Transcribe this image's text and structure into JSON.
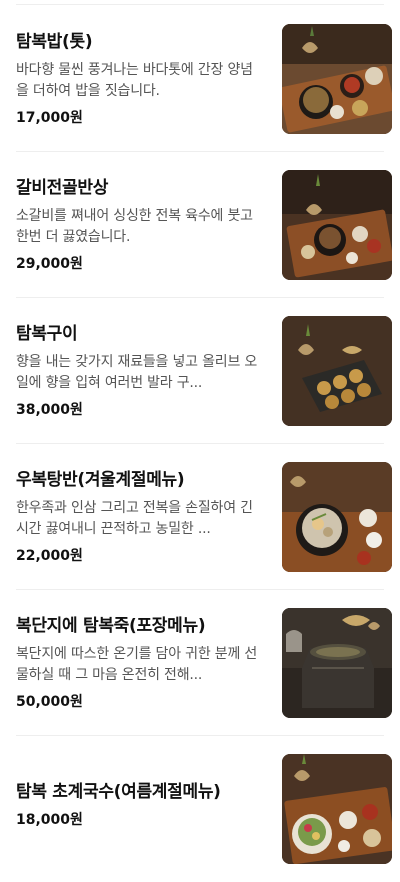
{
  "menu": {
    "items": [
      {
        "name": "탐복밥(톳)",
        "description": "바다향 물씬 풍겨나는 바다톳에 간장 양념을 더하여 밥을 짓습니다.",
        "price": "17,000원",
        "image": "tambok-rice-set-photo"
      },
      {
        "name": "갈비전골반상",
        "description": "소갈비를 쪄내어 싱싱한 전복 육수에 붓고 한번 더 끓였습니다.",
        "price": "29,000원",
        "image": "galbi-hotpot-set-photo"
      },
      {
        "name": "탐복구이",
        "description": "향을 내는 갖가지 재료들을 넣고 올리브 오일에 향을 입혀 여러번 발라 구...",
        "price": "38,000원",
        "image": "grilled-abalone-photo"
      },
      {
        "name": "우복탕반(겨울계절메뉴)",
        "description": "한우족과 인삼 그리고 전복을 손질하여 긴 시간 끓여내니 끈적하고 농밀한 ...",
        "price": "22,000원",
        "image": "ox-foot-soup-photo"
      },
      {
        "name": "복단지에 탐복죽(포장메뉴)",
        "description": "복단지에 따스한 온기를 담아 귀한 분께 선물하실 때 그 마음 온전히 전해...",
        "price": "50,000원",
        "image": "abalone-porridge-jar-photo"
      },
      {
        "name": "탐복 초계국수(여름계절메뉴)",
        "description": "",
        "price": "18,000원",
        "image": "cold-chicken-noodle-photo"
      }
    ]
  }
}
